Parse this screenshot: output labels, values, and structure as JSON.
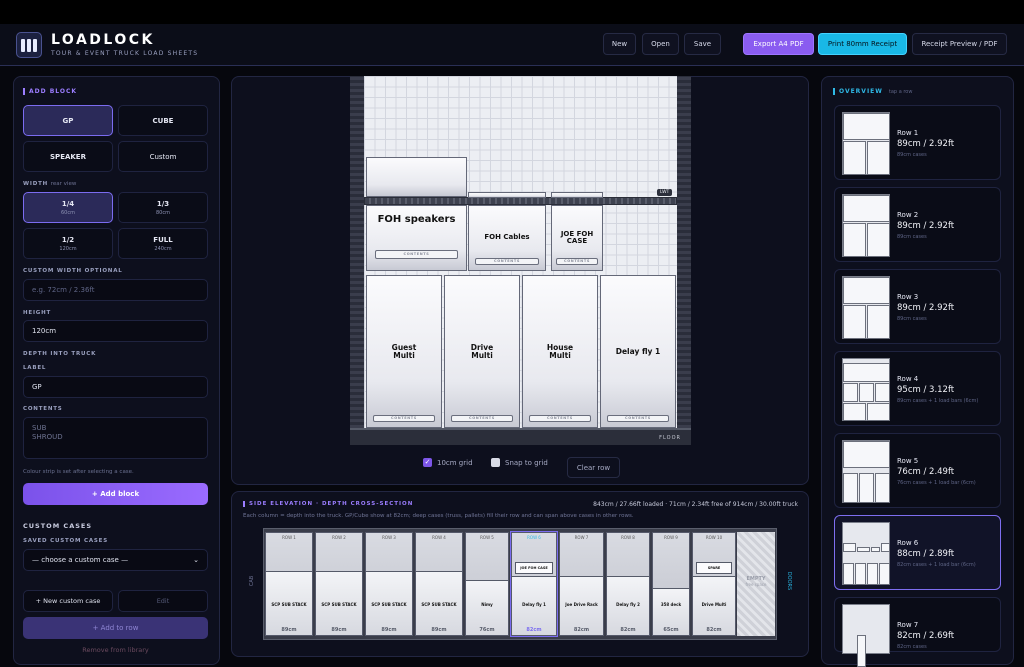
{
  "app": {
    "brand": "LOADLOCK",
    "tagline": "TOUR & EVENT TRUCK LOAD SHEETS"
  },
  "header": {
    "new": "New",
    "open": "Open",
    "save": "Save",
    "export_pdf": "Export A4 PDF",
    "print_receipt": "Print 80mm Receipt",
    "receipt_preview": "Receipt Preview / PDF"
  },
  "add_block": {
    "title": "ADD BLOCK",
    "types": [
      "GP",
      "CUBE",
      "SPEAKER",
      "Custom"
    ],
    "width_label": "WIDTH",
    "width_hint": "rear view",
    "widths": [
      {
        "label": "1/4",
        "sub": "60cm"
      },
      {
        "label": "1/3",
        "sub": "80cm"
      },
      {
        "label": "1/2",
        "sub": "120cm"
      },
      {
        "label": "FULL",
        "sub": "240cm"
      }
    ],
    "custom_width_label": "CUSTOM WIDTH OPTIONAL",
    "custom_width_placeholder": "e.g. 72cm / 2.36ft",
    "height_label": "HEIGHT",
    "height_value": "120cm",
    "depth_label": "DEPTH INTO TRUCK",
    "label_label": "LABEL",
    "label_value": "GP",
    "contents_label": "CONTENTS",
    "contents_line1": "SUB",
    "contents_line2": "SHROUD",
    "colour_note": "Colour strip is set after selecting a case.",
    "add_button": "+ Add block",
    "custom_cases_title": "CUSTOM CASES",
    "saved_label": "SAVED CUSTOM CASES",
    "saved_select": "— choose a custom case —",
    "new_custom": "+ New custom case",
    "edit": "Edit",
    "add_to_row": "+ Add to row",
    "remove": "Remove from library"
  },
  "rear_view": {
    "lwt": "LWT",
    "floor": "FLOOR",
    "contents_tag": "CONTENTS",
    "cases": [
      "FOH speakers",
      "FOH Cables",
      "JOE FOH CASE",
      "Guest Multi",
      "Drive Multi",
      "House Multi",
      "Delay fly 1"
    ],
    "controls": {
      "grid": "10cm grid",
      "snap": "Snap to grid",
      "clear": "Clear row"
    }
  },
  "side": {
    "title": "SIDE ELEVATION · DEPTH CROSS-SECTION",
    "stats": "843cm / 27.66ft loaded · 71cm / 2.34ft free of 914cm / 30.00ft truck",
    "desc": "Each column = depth into the truck. GP/Cube show at 82cm; deep cases (truss, pallets) fill their row and can span above cases in other rows.",
    "cab": "CAB",
    "doors": "DOORS",
    "empty": "EMPTY",
    "empty_sub": "free space",
    "cols": [
      {
        "top": "ROW 1",
        "label": "SCP SUB STACK",
        "dim": "89cm"
      },
      {
        "top": "ROW 2",
        "label": "SCP SUB STACK",
        "dim": "89cm"
      },
      {
        "top": "ROW 3",
        "label": "SCP SUB STACK",
        "dim": "89cm"
      },
      {
        "top": "ROW 4",
        "label": "SCP SUB STACK",
        "dim": "89cm"
      },
      {
        "top": "ROW 5",
        "label": "Nimy",
        "dim": "76cm"
      },
      {
        "top": "ROW 6",
        "label": "Delay fly 1",
        "dim": "82cm",
        "sub": "JOE FOH CASE"
      },
      {
        "top": "ROW 7",
        "label": "Joe Drive Rack",
        "dim": "82cm"
      },
      {
        "top": "ROW 8",
        "label": "Delay fly 2",
        "dim": "82cm"
      },
      {
        "top": "ROW 9",
        "label": "358 deck",
        "dim": "65cm"
      },
      {
        "top": "ROW 10",
        "label": "Drive Multi",
        "dim": "82cm",
        "sub": "SPARE"
      }
    ]
  },
  "overview": {
    "title": "OVERVIEW",
    "hint": "tap a row",
    "rows": [
      {
        "name": "Row 1",
        "dims": "89cm / 2.92ft",
        "sub": "89cm cases"
      },
      {
        "name": "Row 2",
        "dims": "89cm / 2.92ft",
        "sub": "89cm cases"
      },
      {
        "name": "Row 3",
        "dims": "89cm / 2.92ft",
        "sub": "89cm cases"
      },
      {
        "name": "Row 4",
        "dims": "95cm / 3.12ft",
        "sub": "89cm cases + 1 load bars (6cm)"
      },
      {
        "name": "Row 5",
        "dims": "76cm / 2.49ft",
        "sub": "76cm cases + 1 load bar (6cm)"
      },
      {
        "name": "Row 6",
        "dims": "88cm / 2.89ft",
        "sub": "82cm cases + 1 load bar (6cm)"
      },
      {
        "name": "Row 7",
        "dims": "82cm / 2.69ft",
        "sub": "82cm cases"
      }
    ]
  },
  "colors": {
    "accent": "#8a5cf0",
    "cyan": "#19b8e6",
    "selected_border": "#7b6cf0",
    "bg": "#06070d"
  }
}
